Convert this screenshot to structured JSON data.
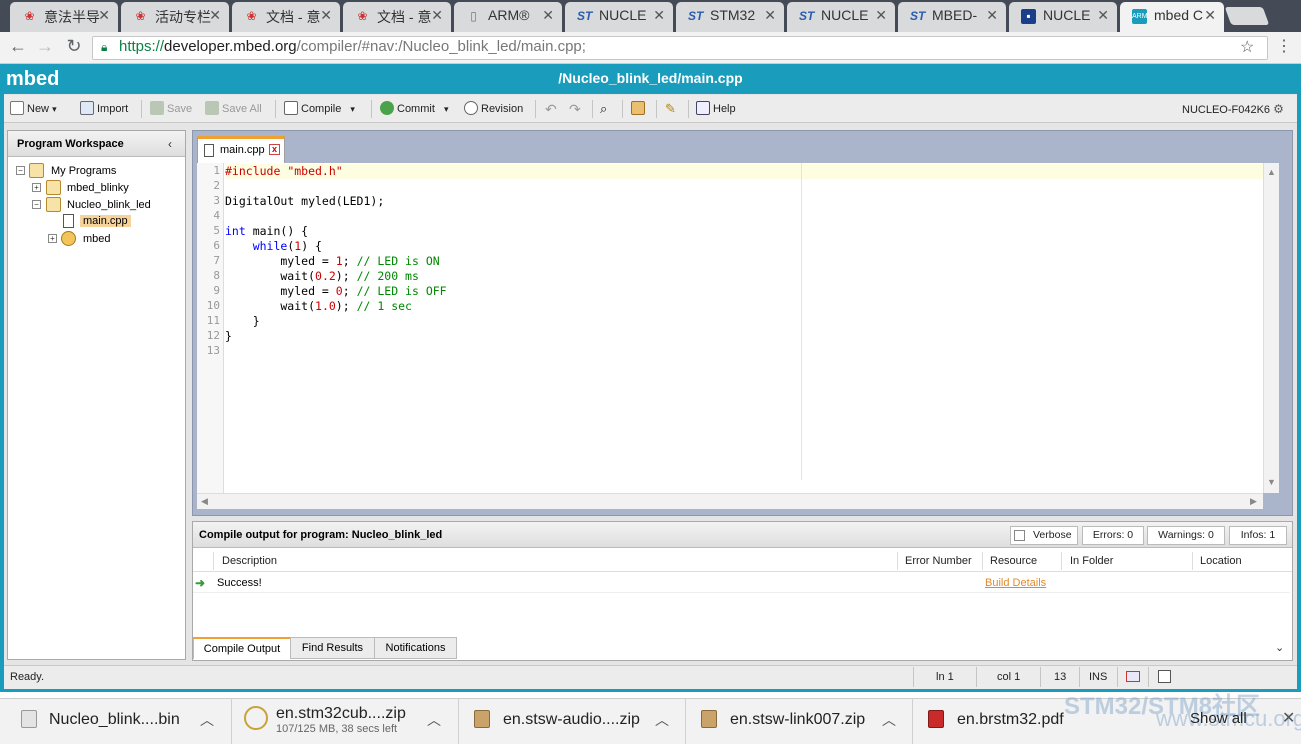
{
  "browser": {
    "tabs": [
      {
        "title": "意法半导",
        "icon": "pdf-icon"
      },
      {
        "title": "活动专栏",
        "icon": "pdf-icon"
      },
      {
        "title": "文档 - 意",
        "icon": "pdf-icon"
      },
      {
        "title": "文档 - 意",
        "icon": "pdf-icon"
      },
      {
        "title": "ARM®",
        "icon": "page-icon"
      },
      {
        "title": "NUCLE",
        "icon": "st-icon"
      },
      {
        "title": "STM32",
        "icon": "st-icon"
      },
      {
        "title": "NUCLE",
        "icon": "st-icon"
      },
      {
        "title": "MBED-",
        "icon": "st-icon"
      },
      {
        "title": "NUCLE",
        "icon": "board-icon"
      },
      {
        "title": "mbed C",
        "icon": "mbed-icon"
      }
    ],
    "url_scheme": "https://",
    "url_domain": "developer.mbed.org",
    "url_path": "/compiler/#nav:/Nucleo_blink_led/main.cpp;"
  },
  "app": {
    "logo": "mbed",
    "title": "/Nucleo_blink_led/main.cpp"
  },
  "toolbar": {
    "new": "New",
    "import": "Import",
    "save": "Save",
    "save_all": "Save All",
    "compile": "Compile",
    "commit": "Commit",
    "revision": "Revision",
    "help": "Help",
    "target": "NUCLEO-F042K6"
  },
  "workspace": {
    "title": "Program Workspace",
    "root": "My Programs",
    "items": [
      "mbed_blinky",
      "Nucleo_blink_led",
      "main.cpp",
      "mbed"
    ]
  },
  "editor": {
    "tab": "main.cpp",
    "close": "x",
    "line_numbers": [
      "1",
      "2",
      "3",
      "4",
      "5",
      "6",
      "7",
      "8",
      "9",
      "10",
      "11",
      "12",
      "13"
    ]
  },
  "compile": {
    "title": "Compile output for program: Nucleo_blink_led",
    "verbose": "Verbose",
    "errors": "Errors: 0",
    "warnings": "Warnings: 0",
    "infos": "Infos: 1",
    "columns": [
      "Description",
      "Error Number",
      "Resource",
      "In Folder",
      "Location"
    ],
    "row_description": "Success!",
    "row_resource": "Build Details",
    "tabs": [
      "Compile Output",
      "Find Results",
      "Notifications"
    ]
  },
  "status": {
    "text": "Ready.",
    "line": "ln 1",
    "col": "col 1",
    "count": "13",
    "mode": "INS"
  },
  "downloads": {
    "items": [
      {
        "name": "Nucleo_blink....bin",
        "sub": ""
      },
      {
        "name": "en.stm32cub....zip",
        "sub": "107/125 MB, 38 secs left"
      },
      {
        "name": "en.stsw-audio....zip",
        "sub": ""
      },
      {
        "name": "en.stsw-link007.zip",
        "sub": ""
      },
      {
        "name": "en.brstm32.pdf",
        "sub": ""
      }
    ],
    "show_all": "Show all"
  },
  "watermark": {
    "line1": "STM32/STM8社区",
    "line2": "www.stmcu.org"
  },
  "colors": {
    "accent": "#1a9cbd",
    "tab_highlight": "#f0a030",
    "link": "#e08a2a"
  }
}
